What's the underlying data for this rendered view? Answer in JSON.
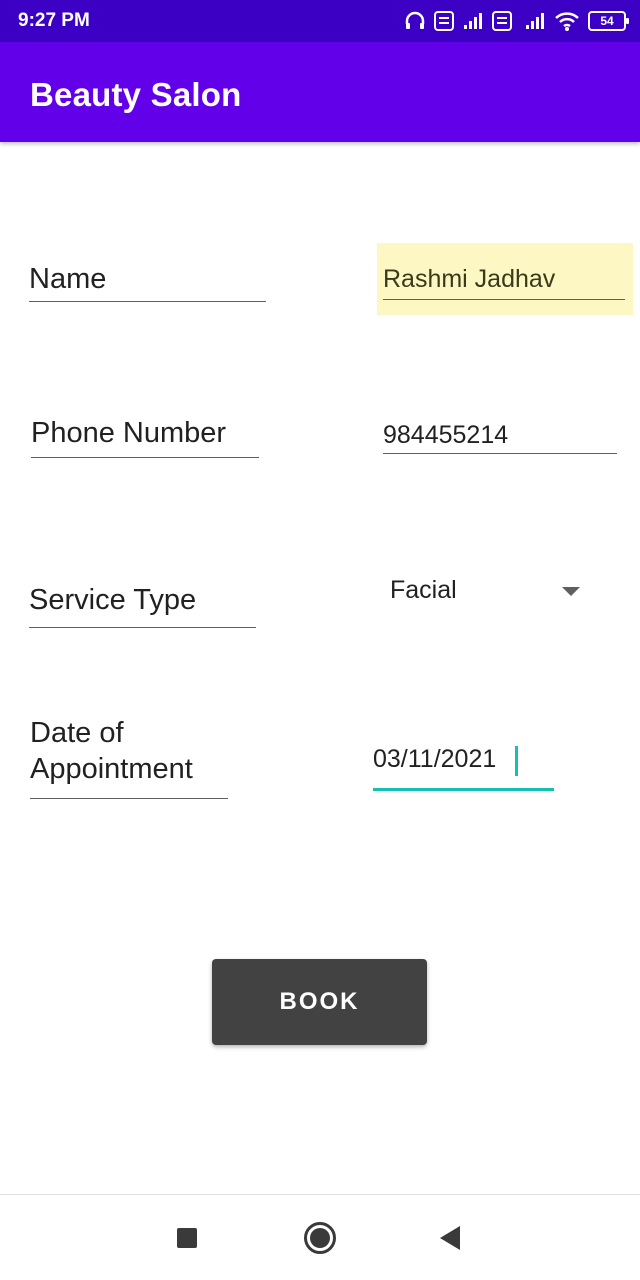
{
  "status_bar": {
    "time": "9:27 PM",
    "battery": "54",
    "icons": [
      "headphones-icon",
      "volte-icon",
      "signal-icon",
      "volte-icon",
      "signal-4g-icon",
      "wifi-icon",
      "battery-icon"
    ]
  },
  "app_bar": {
    "title": "Beauty Salon"
  },
  "form": {
    "name_label": "Name",
    "name_value": "Rashmi Jadhav",
    "phone_label": "Phone Number",
    "phone_value": "984455214",
    "service_label": "Service Type",
    "service_selected": "Facial",
    "date_label_line1": "Date of",
    "date_label_line2": "Appointment",
    "date_value": "03/11/2021"
  },
  "actions": {
    "book_label": "BOOK"
  },
  "colors": {
    "status_bar": "#3c00c4",
    "app_bar": "#6200ea",
    "button": "#424242",
    "focus_accent": "#14c1b0",
    "highlight": "#fdf7c4"
  },
  "nav_bar": {
    "icons": [
      "recents-icon",
      "home-icon",
      "back-icon"
    ]
  }
}
